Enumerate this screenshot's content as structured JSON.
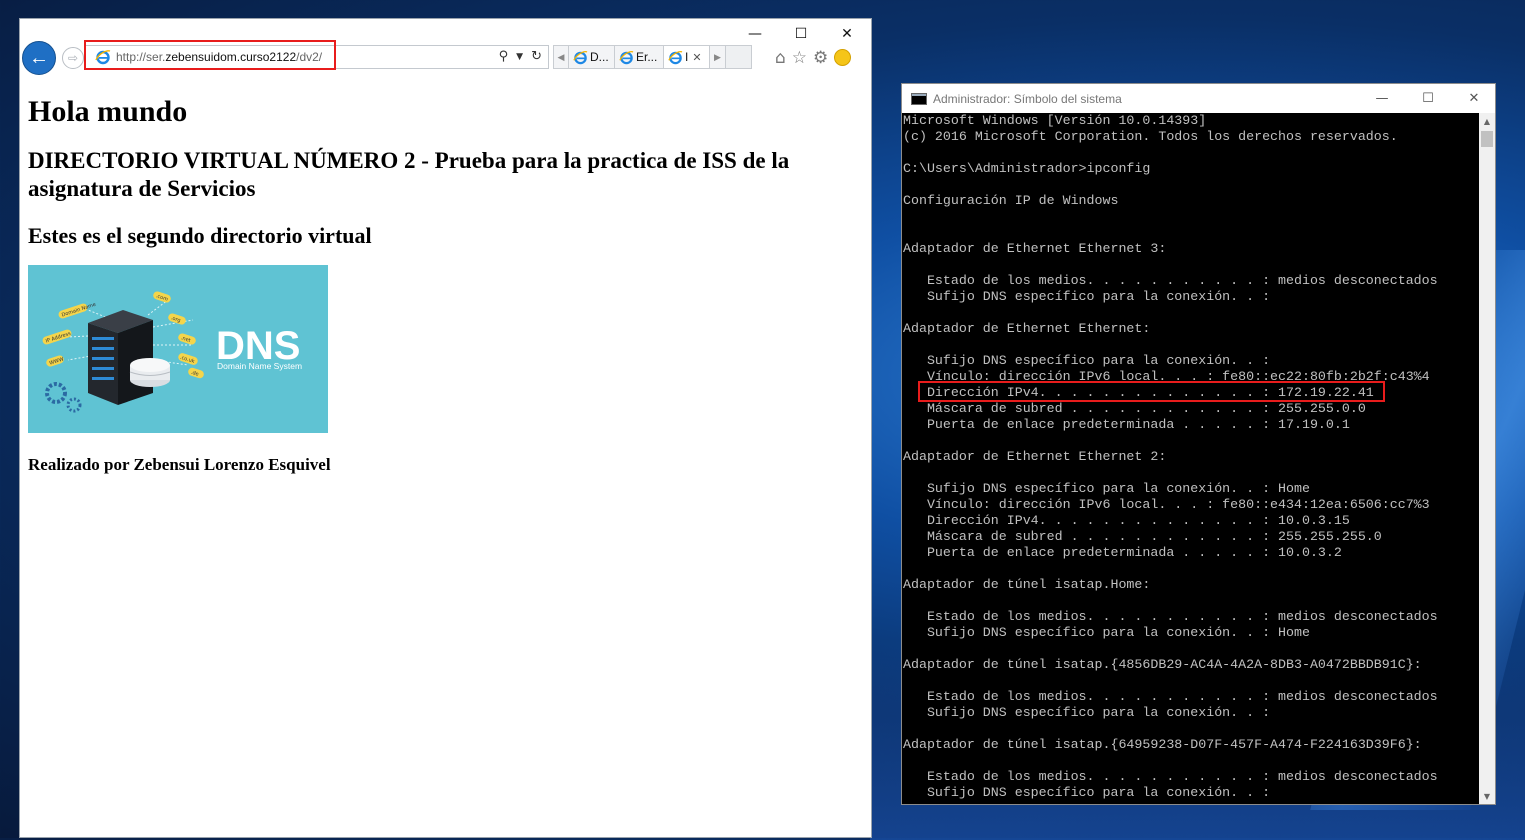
{
  "browser": {
    "url_prefix": "http://ser.",
    "url_host": "zebensuidom.curso2122",
    "url_path": "/dv2/",
    "tabs": [
      {
        "label": "D..."
      },
      {
        "label": "Er..."
      },
      {
        "label": "I"
      }
    ],
    "window_controls": {
      "minimize": "—",
      "maximize": "☐",
      "close": "✕"
    }
  },
  "webpage": {
    "h1": "Hola mundo",
    "h2": "DIRECTORIO VIRTUAL NÚMERO 2 - Prueba para la practica de ISS de la asignatura de Servicios",
    "h3": "Estes es el segundo directorio virtual",
    "footer": "Realizado por Zebensui Lorenzo Esquivel",
    "image": {
      "title": "DNS",
      "subtitle": "Domain Name System",
      "tags": [
        "Domain Name",
        "IP Address",
        "WWW",
        ".com",
        ".org",
        ".net",
        ".co.uk",
        ".de",
        ".org.uk"
      ],
      "bg_color": "#5fc3d3"
    }
  },
  "cmd": {
    "title": "Administrador: Símbolo del sistema",
    "lines": [
      "Microsoft Windows [Versión 10.0.14393]",
      "(c) 2016 Microsoft Corporation. Todos los derechos reservados.",
      "",
      "C:\\Users\\Administrador>ipconfig",
      "",
      "Configuración IP de Windows",
      "",
      "",
      "Adaptador de Ethernet Ethernet 3:",
      "",
      "   Estado de los medios. . . . . . . . . . . : medios desconectados",
      "   Sufijo DNS específico para la conexión. . :",
      "",
      "Adaptador de Ethernet Ethernet:",
      "",
      "   Sufijo DNS específico para la conexión. . :",
      "   Vínculo: dirección IPv6 local. . . : fe80::ec22:80fb:2b2f:c43%4",
      "   Dirección IPv4. . . . . . . . . . . . . . : 172.19.22.41",
      "   Máscara de subred . . . . . . . . . . . . : 255.255.0.0",
      "   Puerta de enlace predeterminada . . . . . : 17.19.0.1",
      "",
      "Adaptador de Ethernet Ethernet 2:",
      "",
      "   Sufijo DNS específico para la conexión. . : Home",
      "   Vínculo: dirección IPv6 local. . . : fe80::e434:12ea:6506:cc7%3",
      "   Dirección IPv4. . . . . . . . . . . . . . : 10.0.3.15",
      "   Máscara de subred . . . . . . . . . . . . : 255.255.255.0",
      "   Puerta de enlace predeterminada . . . . . : 10.0.3.2",
      "",
      "Adaptador de túnel isatap.Home:",
      "",
      "   Estado de los medios. . . . . . . . . . . : medios desconectados",
      "   Sufijo DNS específico para la conexión. . : Home",
      "",
      "Adaptador de túnel isatap.{4856DB29-AC4A-4A2A-8DB3-A0472BBDB91C}:",
      "",
      "   Estado de los medios. . . . . . . . . . . : medios desconectados",
      "   Sufijo DNS específico para la conexión. . :",
      "",
      "Adaptador de túnel isatap.{64959238-D07F-457F-A474-F224163D39F6}:",
      "",
      "   Estado de los medios. . . . . . . . . . . : medios desconectados",
      "   Sufijo DNS específico para la conexión. . :"
    ],
    "window_controls": {
      "minimize": "—",
      "maximize": "☐",
      "close": "✕"
    }
  },
  "colors": {
    "highlight": "#e81c1c",
    "ie_accent": "#1f6fc4",
    "console_bg": "#000000",
    "console_text": "#c0c0c0"
  }
}
